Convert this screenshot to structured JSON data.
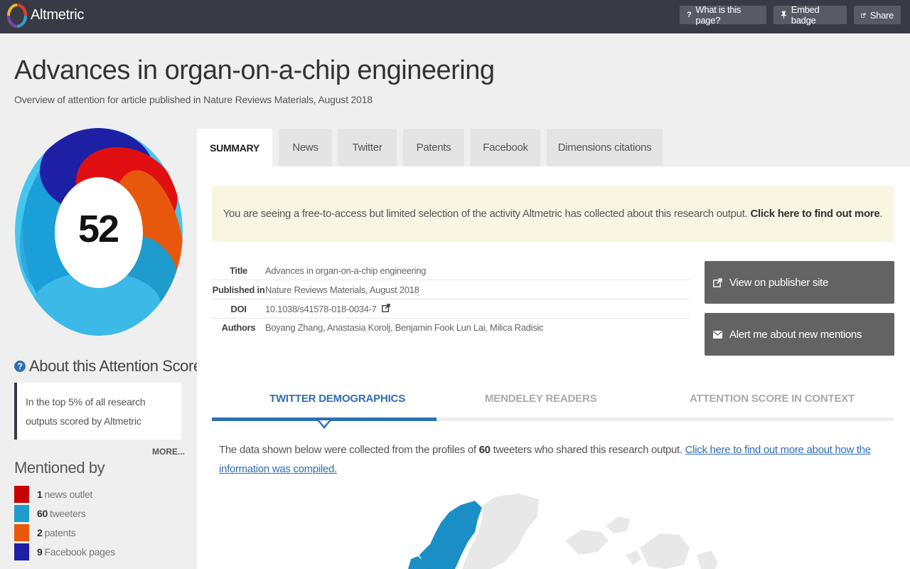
{
  "header": {
    "brand": "Altmetric",
    "buttons": [
      {
        "icon": "?",
        "label": "What is this page?"
      },
      {
        "icon": "pin",
        "label": "Embed badge"
      },
      {
        "icon": "share",
        "label": "Share"
      }
    ]
  },
  "article": {
    "title": "Advances in organ-on-a-chip engineering",
    "subtitle": "Overview of attention for article published in Nature Reviews Materials, August 2018"
  },
  "sidebar": {
    "score": "52",
    "about_title": "About this Attention Score",
    "about_text": "In the top 5% of all research outputs scored by Altmetric",
    "more": "MORE...",
    "mentioned_title": "Mentioned by",
    "mentions": [
      {
        "count": "1",
        "label": "news outlet",
        "color": "#c70000"
      },
      {
        "count": "60",
        "label": "tweeters",
        "color": "#1e9ccc"
      },
      {
        "count": "2",
        "label": "patents",
        "color": "#e8580c"
      },
      {
        "count": "9",
        "label": "Facebook pages",
        "color": "#1d1fa5"
      }
    ]
  },
  "tabs": [
    "SUMMARY",
    "News",
    "Twitter",
    "Patents",
    "Facebook",
    "Dimensions citations"
  ],
  "notice": {
    "text": "You are seeing a free-to-access but limited selection of the activity Altmetric has collected about this research output.",
    "link": "Click here to find out more",
    "end": "."
  },
  "meta": [
    {
      "key": "Title",
      "value": "Advances in organ-on-a-chip engineering"
    },
    {
      "key": "Published in",
      "value": "Nature Reviews Materials, August 2018"
    },
    {
      "key": "DOI",
      "value": "10.1038/s41578-018-0034-7"
    },
    {
      "key": "Authors",
      "value": "Boyang Zhang, Anastasia Korolj, Benjamin Fook Lun Lai, Milica Radisic"
    }
  ],
  "actions": [
    {
      "icon": "external-link",
      "label": "View on publisher site"
    },
    {
      "icon": "envelope",
      "label": "Alert me about new mentions"
    }
  ],
  "subtabs": [
    "TWITTER DEMOGRAPHICS",
    "MENDELEY READERS",
    "ATTENTION SCORE IN CONTEXT"
  ],
  "demographics": {
    "text_before": "The data shown below were collected from the profiles of",
    "count": "60",
    "text_after": "tweeters who shared this research output.",
    "link": "Click here to find out more about how the information was compiled."
  },
  "colors": {
    "topbar": "#383a46",
    "accent": "#2e6fb4",
    "notice_bg": "#f8f5e3",
    "button_bg": "#636363"
  }
}
